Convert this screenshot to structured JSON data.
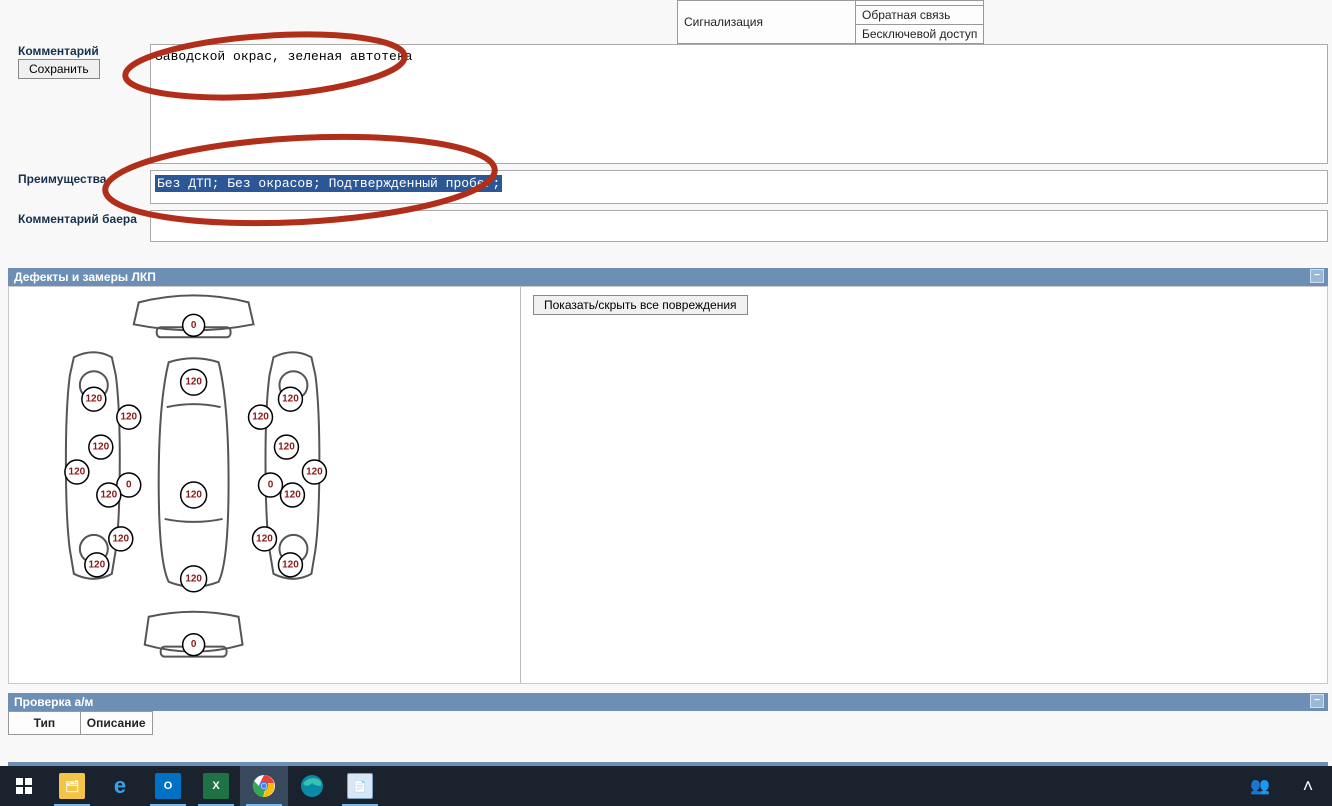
{
  "features": {
    "row1": {
      "c1": "Сигнализация",
      "c2": ""
    },
    "row2": {
      "c2": "Обратная связь"
    },
    "row3": {
      "c2": "Бесключевой доступ"
    }
  },
  "form": {
    "comment_label": "Комментарий",
    "save_label": "Сохранить",
    "comment_value": "Заводской окрас, зеленая автотека",
    "advantages_label": "Преимущества",
    "advantages_value": "Без ДТП; Без окрасов; Подтвержденный пробег;",
    "buyer_comment_label": "Комментарий баера",
    "buyer_comment_value": ""
  },
  "sections": {
    "defects_title": "Дефекты и замеры ЛКП",
    "check_title": "Проверка а/м"
  },
  "damage": {
    "toggle_label": "Показать/скрыть все повреждения"
  },
  "check_table": {
    "col_type": "Тип",
    "col_desc": "Описание"
  },
  "measurements": {
    "front_bumper": "0",
    "rear_bumper": "0",
    "hood": "120",
    "roof": "120",
    "trunk": "120",
    "left": {
      "p1": "120",
      "p2": "120",
      "p3": "120",
      "p4": "120",
      "p5": "0",
      "p6": "120",
      "p7": "120",
      "p8": "120"
    },
    "right": {
      "p1": "120",
      "p2": "120",
      "p3": "120",
      "p4": "120",
      "p5": "0",
      "p6": "120",
      "p7": "120",
      "p8": "120"
    }
  }
}
